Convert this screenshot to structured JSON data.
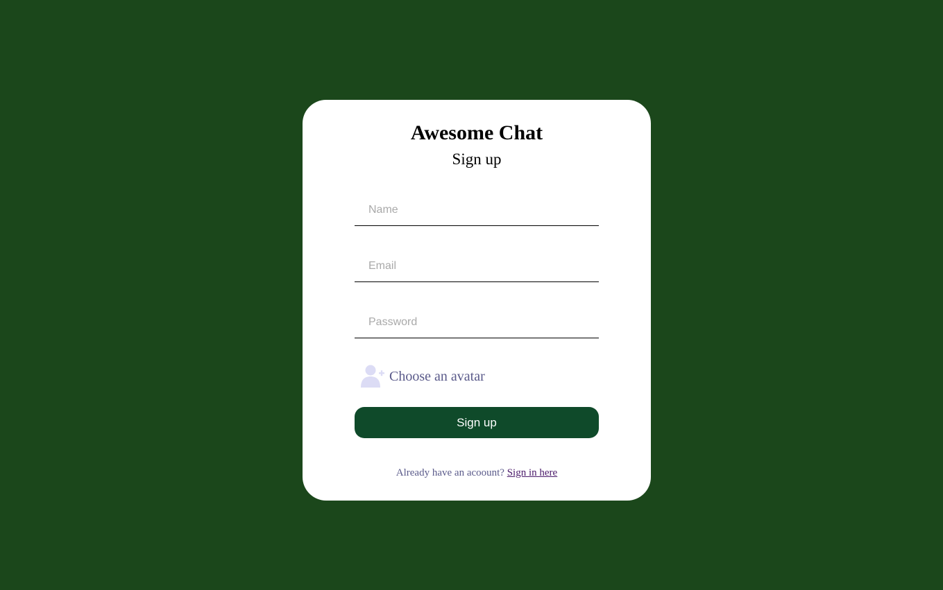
{
  "app": {
    "title": "Awesome Chat",
    "subtitle": "Sign up"
  },
  "form": {
    "name": {
      "placeholder": "Name",
      "value": ""
    },
    "email": {
      "placeholder": "Email",
      "value": ""
    },
    "password": {
      "placeholder": "Password",
      "value": ""
    },
    "avatar": {
      "label": "Choose an avatar",
      "icon": "add-user-icon"
    },
    "submit_label": "Sign up"
  },
  "footer": {
    "text": "Already have an acoount?",
    "link_label": "Sign in here"
  },
  "colors": {
    "background": "#1b471b",
    "card": "#ffffff",
    "button": "#0f4a2a",
    "avatar_icon": "#dcdcf5"
  }
}
